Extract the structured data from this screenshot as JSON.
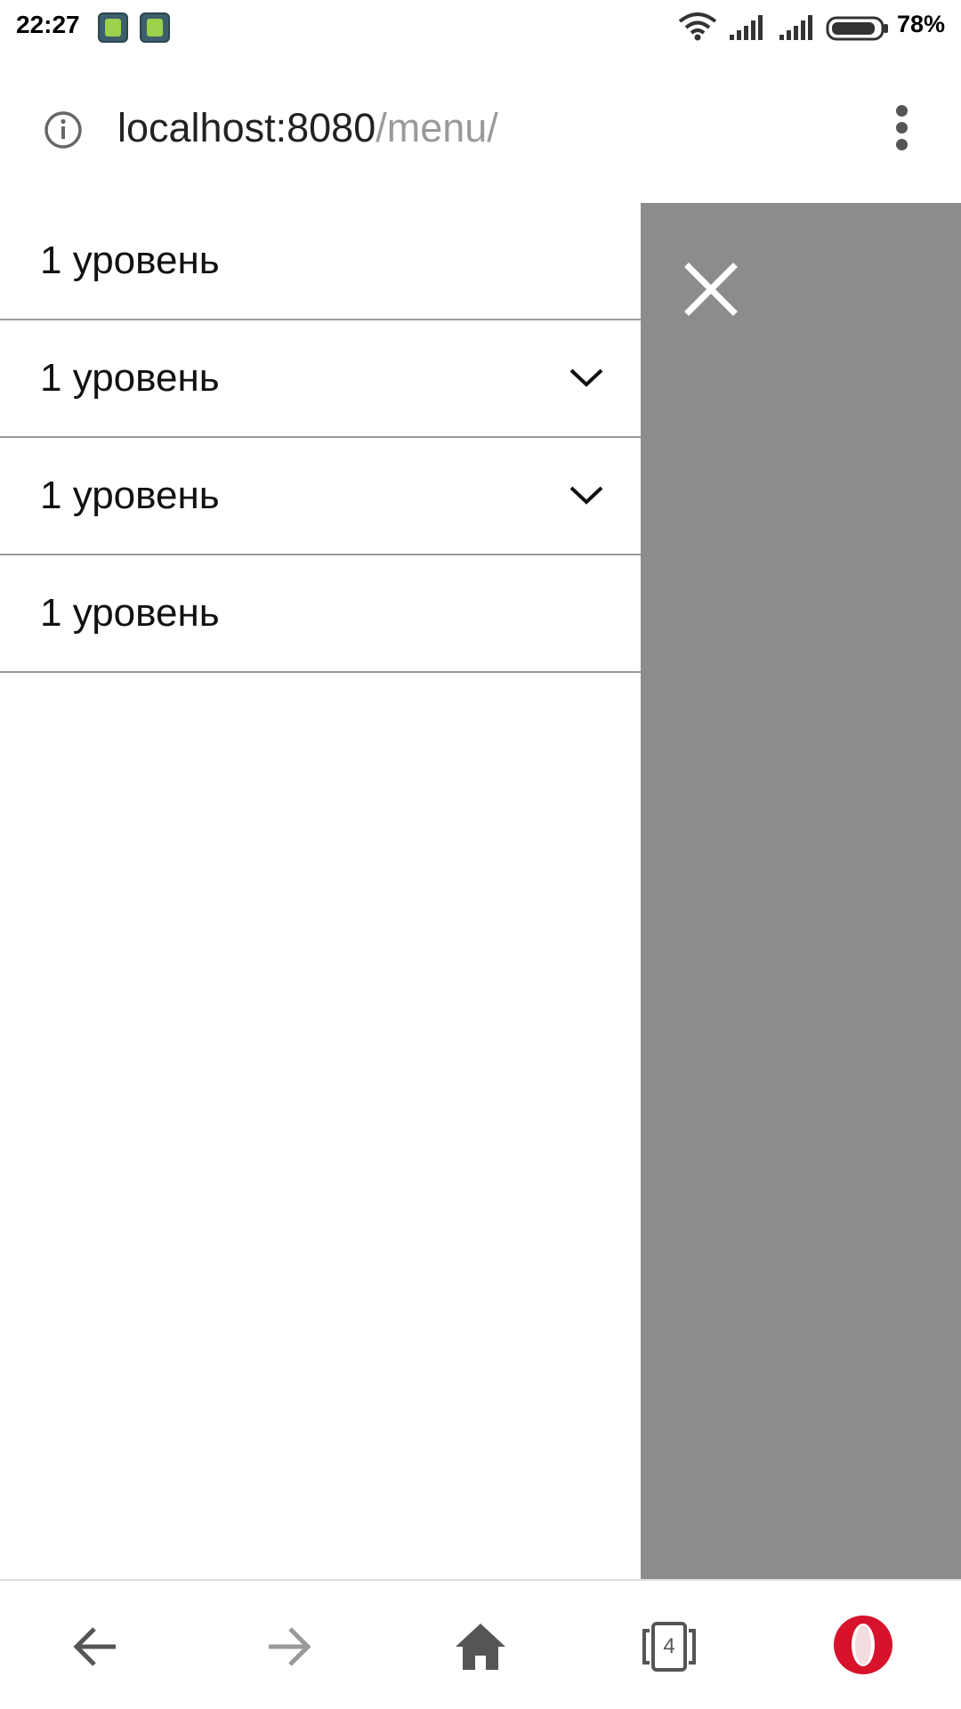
{
  "status_bar": {
    "time": "22:27",
    "battery": "78%",
    "icons": [
      "notification-app-icon",
      "notification-app-icon",
      "wifi-icon",
      "signal-icon",
      "signal-icon",
      "battery-icon"
    ]
  },
  "address_bar": {
    "host": "localhost:8080",
    "path": "/menu/",
    "icons": [
      "info-icon",
      "kebab-menu-icon"
    ]
  },
  "menu": {
    "items": [
      {
        "label": "1 уровень",
        "expandable": false
      },
      {
        "label": "1 уровень",
        "expandable": true,
        "icon": "chevron-down-icon"
      },
      {
        "label": "1 уровень",
        "expandable": true,
        "icon": "chevron-down-icon"
      },
      {
        "label": "1 уровень",
        "expandable": false
      }
    ],
    "close_icon": "close-icon"
  },
  "bottom_nav": {
    "tab_count": "4",
    "buttons": [
      "back-arrow-icon",
      "forward-arrow-icon",
      "home-icon",
      "tabs-icon",
      "opera-logo-icon"
    ]
  },
  "colors": {
    "overlay": "#8c8c8c",
    "divider": "#999999",
    "opera_red": "#d6132b",
    "url_path": "#9a9a9a"
  }
}
